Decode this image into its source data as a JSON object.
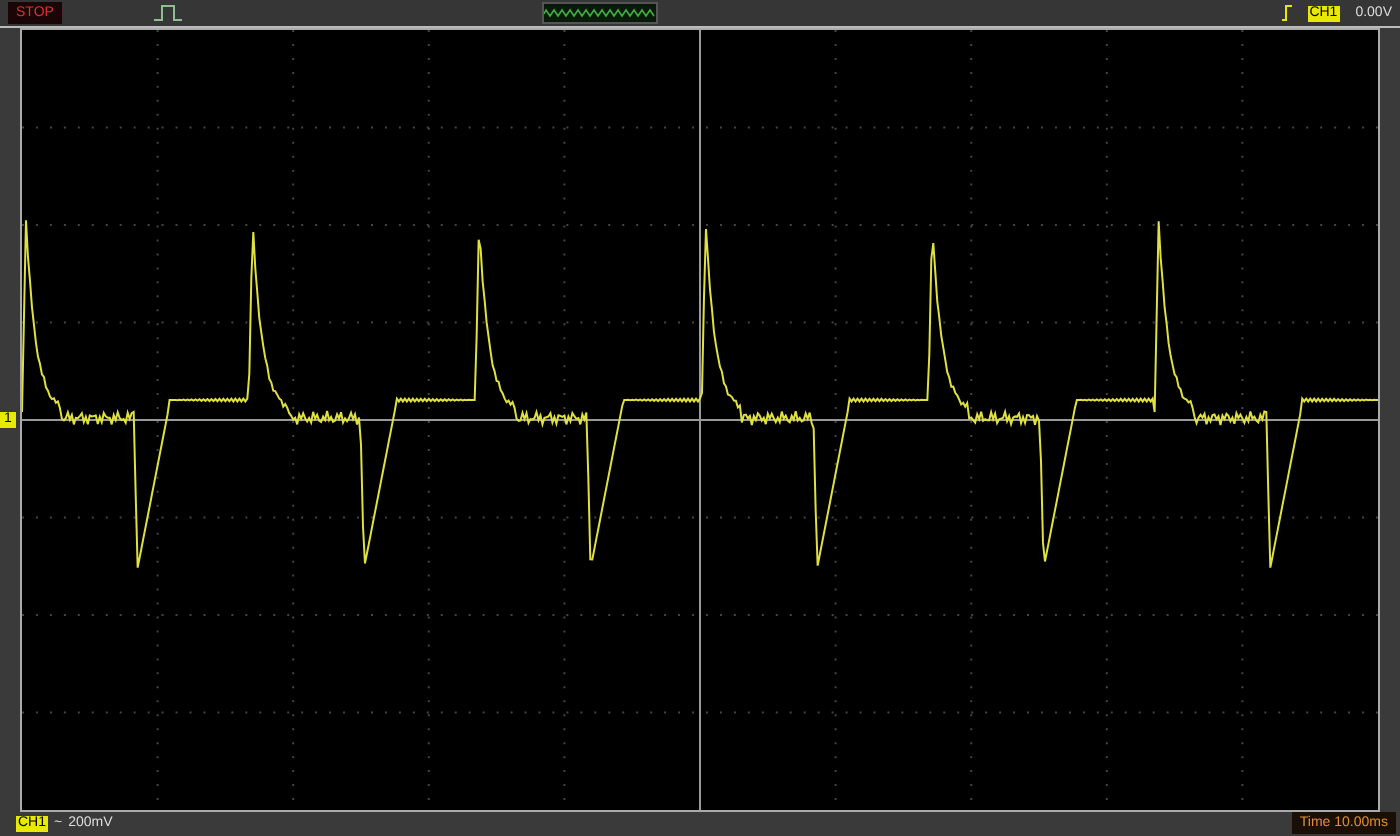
{
  "top_bar": {
    "run_state": "STOP",
    "trigger_channel": "CH1",
    "trigger_level": "0.00V"
  },
  "screen": {
    "channel_marker": "1"
  },
  "bottom_bar": {
    "channel": "CH1",
    "coupling": "~",
    "volts_per_div": "200mV",
    "timebase": "Time 10.00ms"
  }
}
